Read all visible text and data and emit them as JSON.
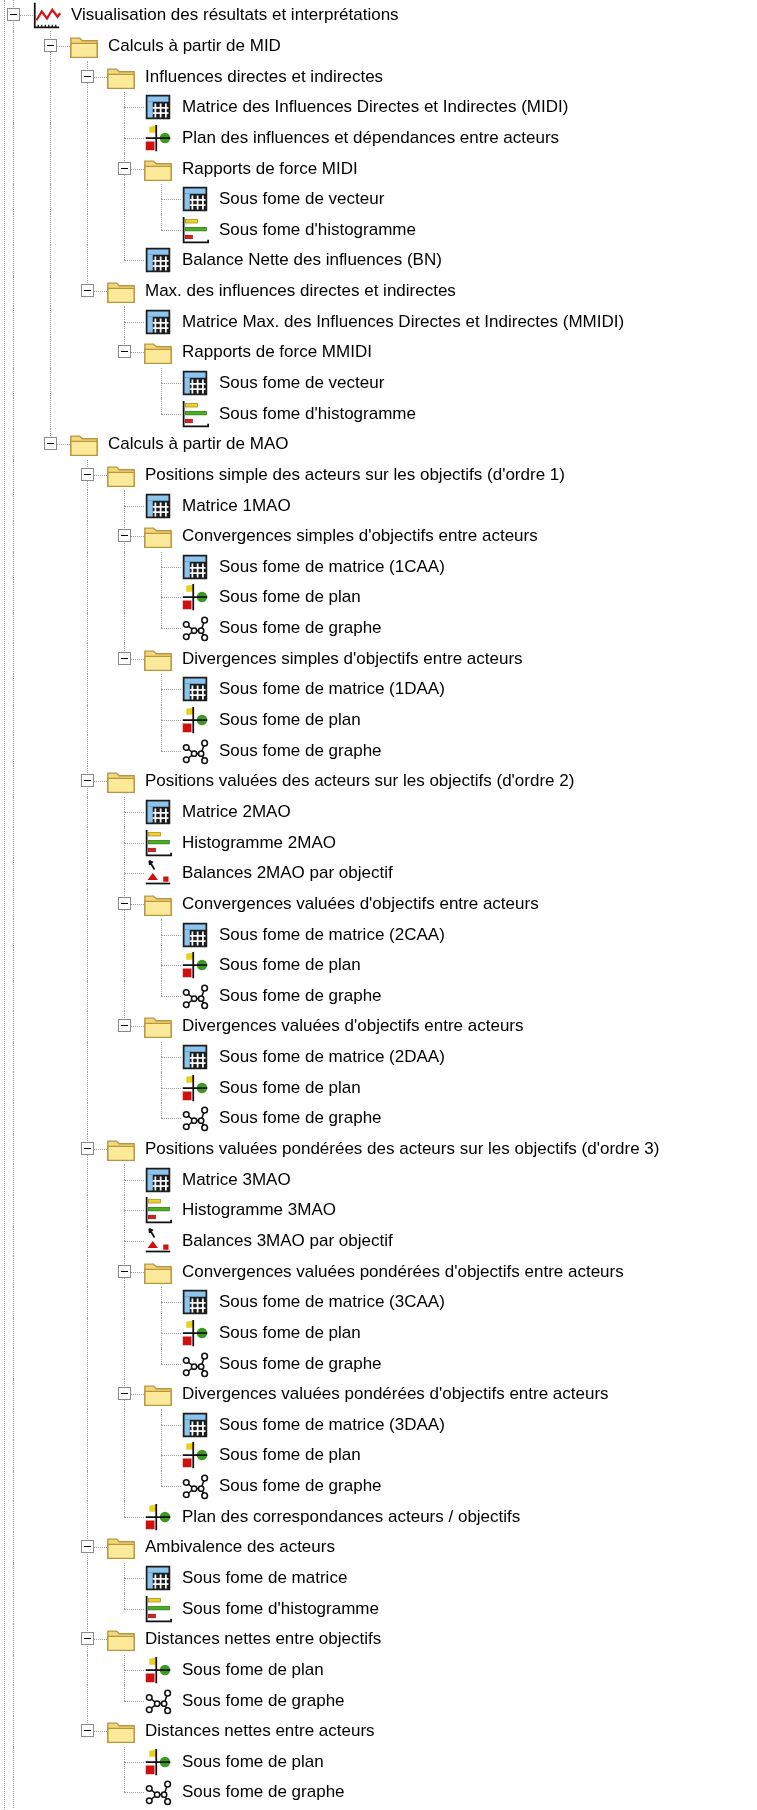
{
  "tree": [
    {
      "label": "Visualisation des résultats et interprétations",
      "kind": "chart",
      "expanded": true,
      "children": [
        {
          "label": "Calculs à partir de MID",
          "kind": "folder",
          "expanded": true,
          "children": [
            {
              "label": "Influences directes et indirectes",
              "kind": "folder",
              "expanded": true,
              "children": [
                {
                  "label": "Matrice des Influences Directes et Indirectes (MIDI)",
                  "kind": "matrix"
                },
                {
                  "label": "Plan des influences et dépendances entre acteurs",
                  "kind": "plan"
                },
                {
                  "label": "Rapports de force MIDI",
                  "kind": "folder",
                  "expanded": true,
                  "children": [
                    {
                      "label": "Sous fome de vecteur",
                      "kind": "matrix"
                    },
                    {
                      "label": "Sous fome d'histogramme",
                      "kind": "histogram"
                    }
                  ]
                },
                {
                  "label": "Balance Nette des influences (BN)",
                  "kind": "matrix"
                }
              ]
            },
            {
              "label": "Max. des influences directes et indirectes",
              "kind": "folder",
              "expanded": true,
              "children": [
                {
                  "label": "Matrice Max. des Influences Directes et Indirectes (MMIDI)",
                  "kind": "matrix"
                },
                {
                  "label": "Rapports de force MMIDI",
                  "kind": "folder",
                  "expanded": true,
                  "children": [
                    {
                      "label": "Sous fome de vecteur",
                      "kind": "matrix"
                    },
                    {
                      "label": "Sous fome d'histogramme",
                      "kind": "histogram"
                    }
                  ]
                }
              ]
            }
          ]
        },
        {
          "label": "Calculs à partir de MAO",
          "kind": "folder",
          "expanded": true,
          "children": [
            {
              "label": "Positions simple des acteurs sur les objectifs (d'ordre 1)",
              "kind": "folder",
              "expanded": true,
              "children": [
                {
                  "label": "Matrice 1MAO",
                  "kind": "matrix"
                },
                {
                  "label": "Convergences simples d'objectifs entre acteurs",
                  "kind": "folder",
                  "expanded": true,
                  "children": [
                    {
                      "label": "Sous fome de matrice (1CAA)",
                      "kind": "matrix"
                    },
                    {
                      "label": "Sous fome de plan",
                      "kind": "plan"
                    },
                    {
                      "label": "Sous fome de graphe",
                      "kind": "graph"
                    }
                  ]
                },
                {
                  "label": "Divergences simples d'objectifs entre acteurs",
                  "kind": "folder",
                  "expanded": true,
                  "children": [
                    {
                      "label": "Sous fome de matrice (1DAA)",
                      "kind": "matrix"
                    },
                    {
                      "label": "Sous fome de plan",
                      "kind": "plan"
                    },
                    {
                      "label": "Sous fome de graphe",
                      "kind": "graph"
                    }
                  ]
                }
              ]
            },
            {
              "label": "Positions valuées des acteurs sur les objectifs (d'ordre 2)",
              "kind": "folder",
              "expanded": true,
              "children": [
                {
                  "label": "Matrice 2MAO",
                  "kind": "matrix"
                },
                {
                  "label": "Histogramme 2MAO",
                  "kind": "histogram"
                },
                {
                  "label": "Balances 2MAO par objectif",
                  "kind": "balance"
                },
                {
                  "label": "Convergences valuées d'objectifs entre acteurs",
                  "kind": "folder",
                  "expanded": true,
                  "children": [
                    {
                      "label": "Sous fome de matrice (2CAA)",
                      "kind": "matrix"
                    },
                    {
                      "label": "Sous fome de plan",
                      "kind": "plan"
                    },
                    {
                      "label": "Sous fome de graphe",
                      "kind": "graph"
                    }
                  ]
                },
                {
                  "label": "Divergences valuées d'objectifs entre acteurs",
                  "kind": "folder",
                  "expanded": true,
                  "children": [
                    {
                      "label": "Sous fome de matrice (2DAA)",
                      "kind": "matrix"
                    },
                    {
                      "label": "Sous fome de plan",
                      "kind": "plan"
                    },
                    {
                      "label": "Sous fome de graphe",
                      "kind": "graph"
                    }
                  ]
                }
              ]
            },
            {
              "label": "Positions valuées pondérées des acteurs sur les objectifs (d'ordre 3)",
              "kind": "folder",
              "expanded": true,
              "children": [
                {
                  "label": "Matrice 3MAO",
                  "kind": "matrix"
                },
                {
                  "label": "Histogramme 3MAO",
                  "kind": "histogram"
                },
                {
                  "label": "Balances 3MAO par objectif",
                  "kind": "balance"
                },
                {
                  "label": "Convergences valuées pondérées d'objectifs entre acteurs",
                  "kind": "folder",
                  "expanded": true,
                  "children": [
                    {
                      "label": "Sous fome de matrice (3CAA)",
                      "kind": "matrix"
                    },
                    {
                      "label": "Sous fome de plan",
                      "kind": "plan"
                    },
                    {
                      "label": "Sous fome de graphe",
                      "kind": "graph"
                    }
                  ]
                },
                {
                  "label": "Divergences valuées pondérées d'objectifs entre acteurs",
                  "kind": "folder",
                  "expanded": true,
                  "children": [
                    {
                      "label": "Sous fome de matrice (3DAA)",
                      "kind": "matrix"
                    },
                    {
                      "label": "Sous fome de plan",
                      "kind": "plan"
                    },
                    {
                      "label": "Sous fome de graphe",
                      "kind": "graph"
                    }
                  ]
                },
                {
                  "label": "Plan des correspondances acteurs / objectifs",
                  "kind": "plan"
                }
              ]
            },
            {
              "label": "Ambivalence des acteurs",
              "kind": "folder",
              "expanded": true,
              "children": [
                {
                  "label": "Sous fome de matrice",
                  "kind": "matrix"
                },
                {
                  "label": "Sous fome d'histogramme",
                  "kind": "histogram"
                }
              ]
            },
            {
              "label": "Distances nettes entre objectifs",
              "kind": "folder",
              "expanded": true,
              "children": [
                {
                  "label": "Sous fome de plan",
                  "kind": "plan"
                },
                {
                  "label": "Sous fome de graphe",
                  "kind": "graph"
                }
              ]
            },
            {
              "label": "Distances nettes entre acteurs",
              "kind": "folder",
              "expanded": true,
              "children": [
                {
                  "label": "Sous fome de plan",
                  "kind": "plan"
                },
                {
                  "label": "Sous fome de graphe",
                  "kind": "graph"
                }
              ]
            }
          ]
        }
      ]
    }
  ]
}
